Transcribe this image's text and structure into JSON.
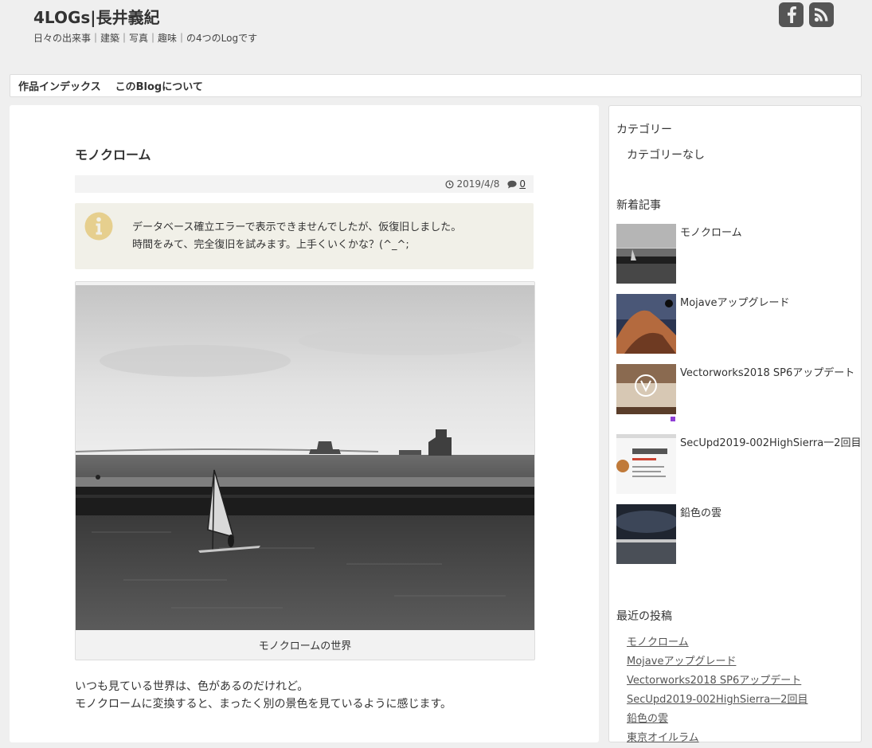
{
  "site": {
    "title": "4LOGs|長井義紀",
    "description": "日々の出来事｜建築｜写真｜趣味｜の4つのLogです"
  },
  "social": [
    "facebook-icon",
    "rss-icon"
  ],
  "nav": {
    "items": [
      {
        "label": "作品インデックス"
      },
      {
        "label": "このBlogについて"
      }
    ]
  },
  "post": {
    "title": "モノクローム",
    "date": "2019/4/8",
    "comments": "0",
    "notice": {
      "line1": "データベース確立エラーで表示できませんでしたが、仮復旧しました。",
      "line2": "時間をみて、完全復旧を試みます。上手くいくかな？(^_^;"
    },
    "caption": "モノクロームの世界",
    "body": {
      "line1": "いつも見ている世界は、色があるのだけれど。",
      "line2": "モノクロームに変換すると、まったく別の景色を見ているように感じます。"
    }
  },
  "sidebar": {
    "categories": {
      "title": "カテゴリー",
      "empty": "カテゴリーなし"
    },
    "new_posts": {
      "title": "新着記事",
      "items": [
        {
          "title": "モノクローム"
        },
        {
          "title": "Mojaveアップグレード"
        },
        {
          "title": "Vectorworks2018 SP6アップデート"
        },
        {
          "title": "SecUpd2019-002HighSierra一2回目"
        },
        {
          "title": "鉛色の雲"
        }
      ]
    },
    "recent": {
      "title": "最近の投稿",
      "items": [
        {
          "title": "モノクローム"
        },
        {
          "title": "Mojaveアップグレード"
        },
        {
          "title": "Vectorworks2018 SP6アップデート"
        },
        {
          "title": "SecUpd2019-002HighSierra一2回目"
        },
        {
          "title": "鉛色の雲"
        },
        {
          "title": "東京オイルラム"
        }
      ]
    }
  }
}
